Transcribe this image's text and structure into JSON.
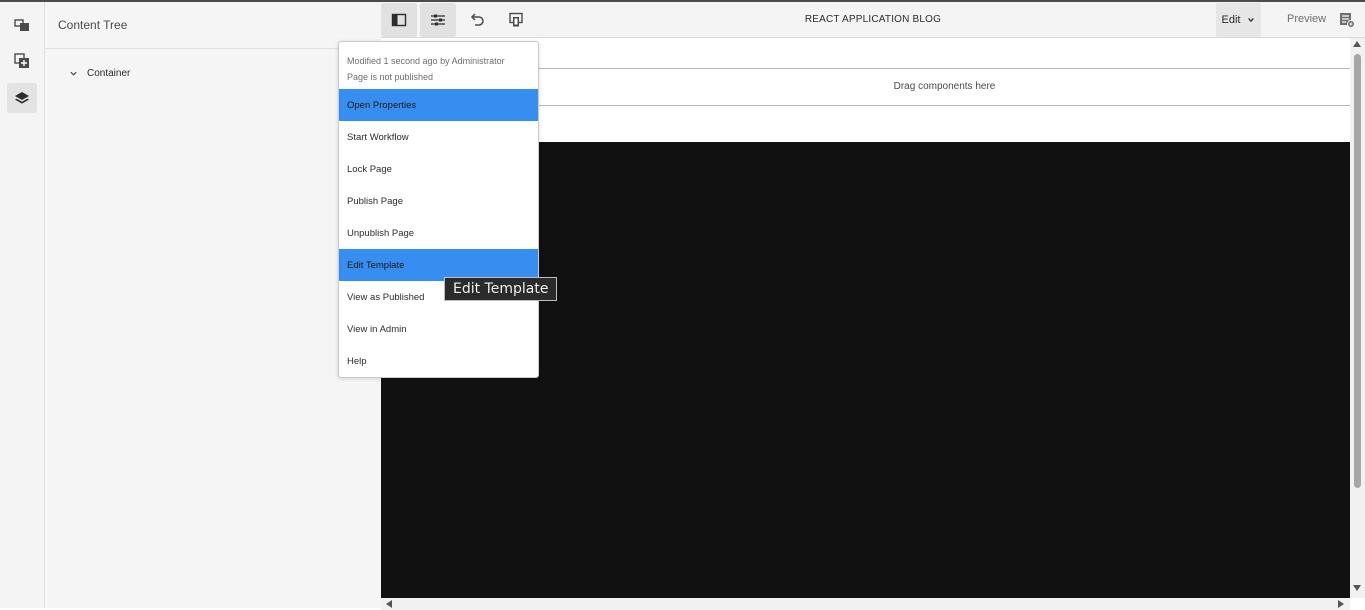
{
  "panel": {
    "title": "Content Tree",
    "tree": [
      {
        "label": "Container",
        "expanded": true
      }
    ]
  },
  "toolbar": {
    "page_title": "REACT APPLICATION BLOG",
    "mode": "Edit",
    "preview": "Preview",
    "icons": [
      "side-panel-icon",
      "page-properties-icon",
      "undo-icon",
      "emulator-icon",
      "annotations-icon"
    ]
  },
  "content": {
    "drag_text": "Drag components here"
  },
  "page_info": {
    "modified": "Modified 1 second ago by Administrator",
    "status": "Page is not published",
    "items": [
      {
        "label": "Open Properties",
        "highlighted": true
      },
      {
        "label": "Start Workflow",
        "highlighted": false
      },
      {
        "label": "Lock Page",
        "highlighted": false
      },
      {
        "label": "Publish Page",
        "highlighted": false
      },
      {
        "label": "Unpublish Page",
        "highlighted": false
      },
      {
        "label": "Edit Template",
        "highlighted": true
      },
      {
        "label": "View as Published",
        "highlighted": false
      },
      {
        "label": "View in Admin",
        "highlighted": false
      },
      {
        "label": "Help",
        "highlighted": false
      }
    ]
  },
  "tooltip": {
    "text": "Edit Template"
  },
  "colors": {
    "highlight": "#378ef0",
    "dark_block": "#111111",
    "rail_bg": "#f4f4f4"
  }
}
